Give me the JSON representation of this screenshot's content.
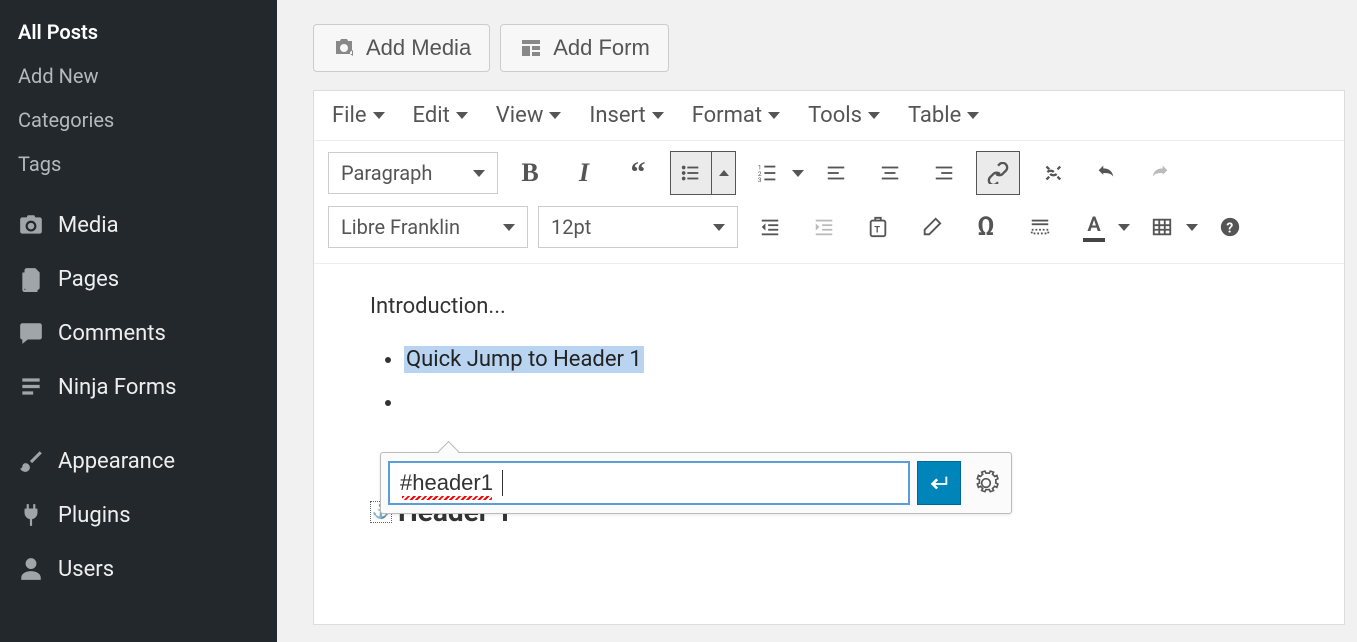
{
  "sidebar": {
    "submenu": [
      {
        "label": "All Posts",
        "active": true
      },
      {
        "label": "Add New",
        "active": false
      },
      {
        "label": "Categories",
        "active": false
      },
      {
        "label": "Tags",
        "active": false
      }
    ],
    "items": [
      {
        "label": "Media"
      },
      {
        "label": "Pages"
      },
      {
        "label": "Comments"
      },
      {
        "label": "Ninja Forms"
      },
      {
        "label": "Appearance"
      },
      {
        "label": "Plugins"
      },
      {
        "label": "Users"
      }
    ]
  },
  "buttons": {
    "add_media": "Add Media",
    "add_form": "Add Form"
  },
  "menubar": [
    "File",
    "Edit",
    "View",
    "Insert",
    "Format",
    "Tools",
    "Table"
  ],
  "toolbar": {
    "paragraph": "Paragraph",
    "font": "Libre Franklin",
    "size": "12pt"
  },
  "content": {
    "intro": "Introduction...",
    "list": [
      "Quick Jump to Header 1"
    ],
    "link_url": "#header1",
    "header": "Header 1"
  }
}
